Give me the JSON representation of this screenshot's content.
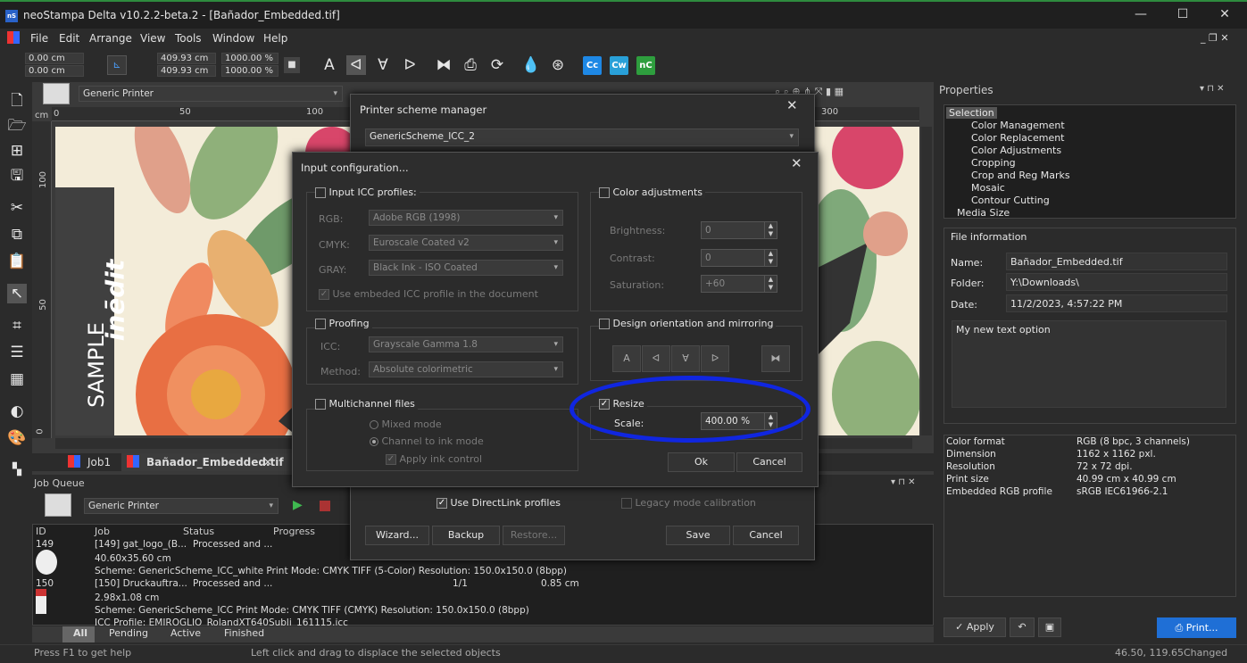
{
  "window": {
    "title": "neoStampa Delta  v10.2.2-beta.2 - [Bañador_Embedded.tif]",
    "logo": "nS",
    "min": "—",
    "max": "☐",
    "close": "✕"
  },
  "menu": [
    "File",
    "Edit",
    "Arrange",
    "View",
    "Tools",
    "Window",
    "Help"
  ],
  "toolbar": {
    "x": "0.00 cm",
    "y": "0.00 cm",
    "w": "409.93 cm",
    "h": "409.93 cm",
    "sw": "1000.00 %",
    "sh": "1000.00 %",
    "cc": "Cc",
    "cw": "Cw",
    "nc": "nC"
  },
  "printer_bar": {
    "printer": "Generic Printer",
    "scheme_partial": "Generic Scheme_ICC_2"
  },
  "ruler": {
    "unit": "cm",
    "h_ticks": [
      "0",
      "50",
      "100",
      "300"
    ],
    "v_ticks": [
      "100",
      "50",
      "0"
    ]
  },
  "artwork": {
    "bold_text": "inēdit",
    "text": "SAMPLE"
  },
  "doc_tabs": {
    "job": "Job1",
    "file": "Bañador_Embedded.tif",
    "close": "✕"
  },
  "properties": {
    "title": "Properties",
    "tree": [
      "Selection",
      "Color Management",
      "Color Replacement",
      "Color Adjustments",
      "Cropping",
      "Crop and Reg Marks",
      "Mosaic",
      "Contour Cutting",
      "Media Size"
    ],
    "file_info_title": "File information",
    "name_label": "Name:",
    "name": "Bañador_Embedded.tif",
    "folder_label": "Folder:",
    "folder": "Y:\\Downloads\\",
    "date_label": "Date:",
    "date": "11/2/2023, 4:57:22 PM",
    "text_option": "My new text option",
    "meta": [
      [
        "Color format",
        "RGB (8 bpc, 3 channels)"
      ],
      [
        "Dimension",
        "1162 x 1162 pxl."
      ],
      [
        "Resolution",
        "72 x 72 dpi."
      ],
      [
        "Print size",
        "40.99 cm x 40.99 cm"
      ],
      [
        "Embedded RGB profile",
        "sRGB IEC61966-2.1"
      ]
    ],
    "apply": "Apply",
    "print": "Print..."
  },
  "job_queue": {
    "title": "Job Queue",
    "printer": "Generic Printer",
    "columns": [
      "ID",
      "Job",
      "Status",
      "Progress"
    ],
    "rows": [
      {
        "id": "149",
        "job": "[149] gat_logo_(B...",
        "status": "Processed and ...",
        "size": "40.60x35.60 cm",
        "scheme": "Scheme: GenericScheme_ICC_white  Print Mode: CMYK TIFF (5-Color)  Resolution: 150.0x150.0 (8bpp)"
      },
      {
        "id": "150",
        "job": "[150] Druckauftra...",
        "status": "Processed and ...",
        "progress": "1/1",
        "len": "0.85 cm",
        "size": "2.98x1.08 cm",
        "scheme": "Scheme: GenericScheme_ICC  Print Mode: CMYK TIFF (CMYK)  Resolution: 150.0x150.0 (8bpp)",
        "icc": "ICC Profile: EMIROGLIO_RolandXT640Subli_161115.icc"
      }
    ],
    "tabs": [
      "All",
      "Pending",
      "Active",
      "Finished"
    ]
  },
  "status": {
    "help": "Press F1 to get help",
    "hint": "Left click and drag to displace the selected objects",
    "coords": "46.50, 119.65",
    "state": "Changed"
  },
  "psm": {
    "title": "Printer scheme manager",
    "scheme": "GenericScheme_ICC_2",
    "directlink": "Use DirectLink profiles",
    "legacy": "Legacy mode calibration",
    "wizard": "Wizard...",
    "backup": "Backup",
    "restore": "Restore...",
    "save": "Save",
    "cancel": "Cancel"
  },
  "ic": {
    "title": "Input configuration...",
    "input_icc": "Input ICC profiles:",
    "rgb_label": "RGB:",
    "rgb": "Adobe RGB (1998)",
    "cmyk_label": "CMYK:",
    "cmyk": "Euroscale Coated v2",
    "gray_label": "GRAY:",
    "gray": "Black Ink - ISO Coated",
    "use_embedded": "Use embeded ICC profile in the document",
    "proofing": "Proofing",
    "icc_label": "ICC:",
    "icc": "Grayscale Gamma 1.8",
    "method_label": "Method:",
    "method": "Absolute colorimetric",
    "multichannel": "Multichannel files",
    "mixed": "Mixed mode",
    "channel": "Channel to ink mode",
    "apply_ink": "Apply ink control",
    "color_adj": "Color adjustments",
    "brightness": "Brightness:",
    "brightness_v": "0",
    "contrast": "Contrast:",
    "contrast_v": "0",
    "saturation": "Saturation:",
    "saturation_v": "+60",
    "design": "Design orientation and mirroring",
    "resize": "Resize",
    "scale_label": "Scale:",
    "scale": "400.00 %",
    "ok": "Ok",
    "cancel": "Cancel"
  },
  "colors": {
    "accent": "#1f6fd6",
    "highlight": "#1026e0"
  }
}
